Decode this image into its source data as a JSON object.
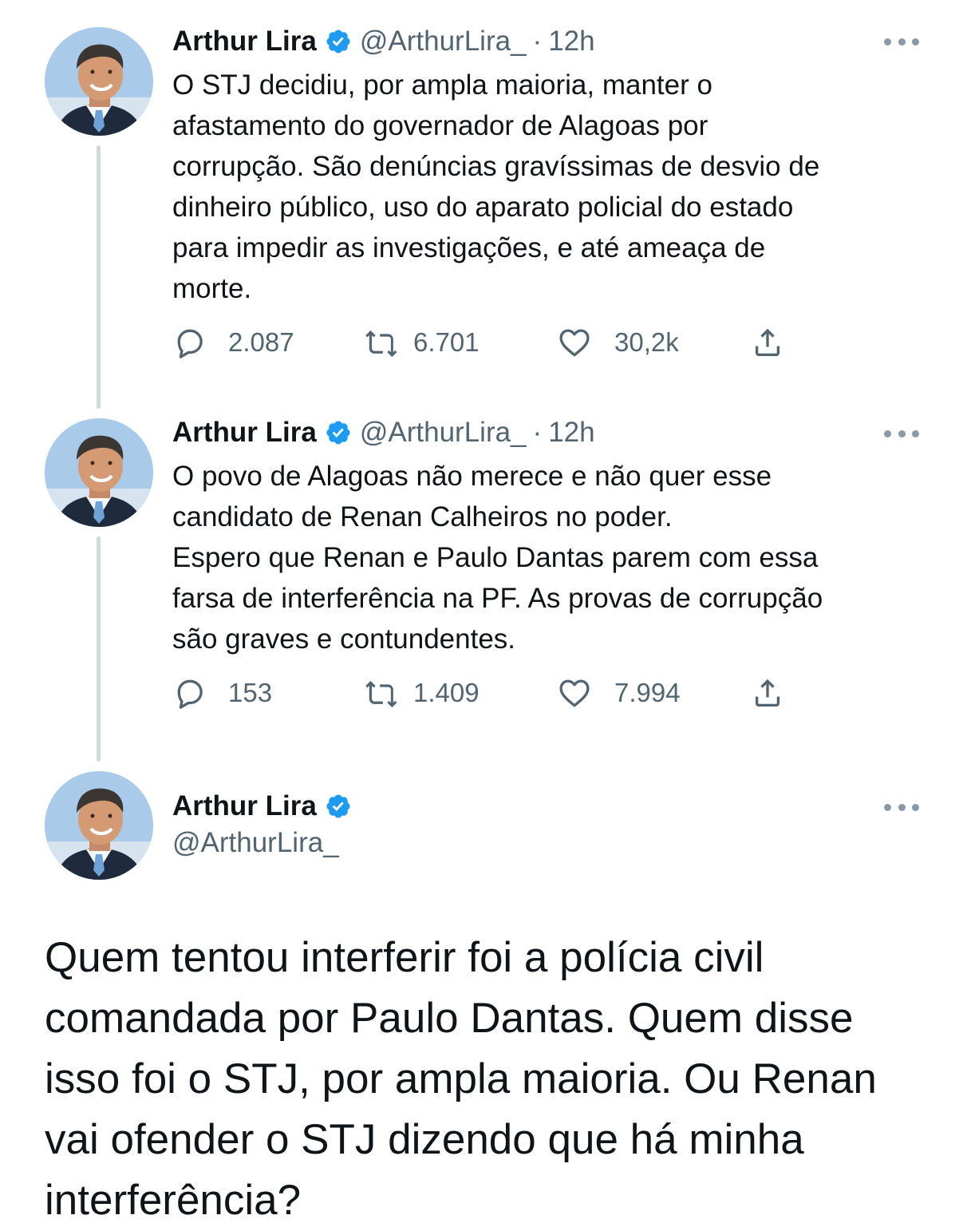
{
  "tweets": [
    {
      "name": "Arthur Lira",
      "handle": "@ArthurLira_",
      "separator": "·",
      "time": "12h",
      "text": "O STJ decidiu, por ampla maioria, manter o\nafastamento do governador de Alagoas por\ncorrupção. São denúncias gravíssimas de desvio de\ndinheiro público, uso do aparato policial do estado\npara impedir as investigações, e até ameaça de\nmorte.",
      "replies": "2.087",
      "retweets": "6.701",
      "likes": "30,2k"
    },
    {
      "name": "Arthur Lira",
      "handle": "@ArthurLira_",
      "separator": "·",
      "time": "12h",
      "text": "O povo de Alagoas não merece e não quer esse\ncandidato de Renan Calheiros  no poder.\nEspero que Renan e Paulo Dantas parem com essa\nfarsa de interferência na PF. As provas de corrupção\nsão graves e contundentes.",
      "replies": "153",
      "retweets": "1.409",
      "likes": "7.994"
    }
  ],
  "main_tweet": {
    "name": "Arthur Lira",
    "handle": "@ArthurLira_",
    "text": "Quem tentou interferir foi a polícia civil\ncomandada por Paulo Dantas. Quem disse\nisso foi o STJ, por ampla maioria. Ou Renan\nvai ofender o STJ dizendo que há minha\ninterferência?"
  },
  "icons": {
    "verified": "verified-badge-icon",
    "reply": "reply-icon",
    "retweet": "retweet-icon",
    "like": "heart-icon",
    "share": "share-icon",
    "more": "more-options-icon"
  },
  "colors": {
    "verified": "#1d9bf0",
    "text": "#0f1419",
    "secondary": "#536471",
    "thread_line": "#cfd9de"
  }
}
